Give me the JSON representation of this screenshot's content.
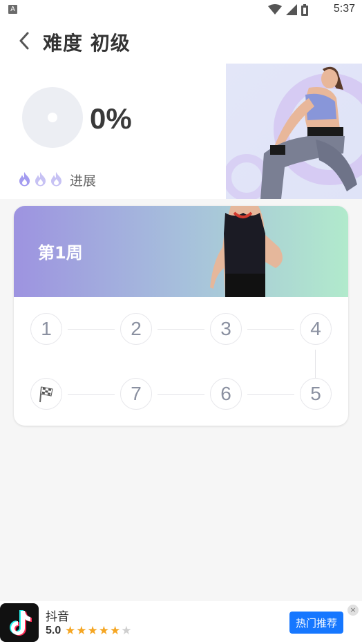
{
  "status_bar": {
    "indicator": "A",
    "time": "5:37",
    "icons": [
      "wifi-icon",
      "signal-icon",
      "battery-icon"
    ]
  },
  "header": {
    "title": "难度 初级"
  },
  "progress": {
    "percent_text": "0%",
    "percent": 0,
    "label": "进展",
    "flame_color": "#8f86e8"
  },
  "week": {
    "title": "第1周",
    "days": [
      "1",
      "2",
      "3",
      "4",
      "5",
      "6",
      "7"
    ],
    "finish_icon": "checkered-flag-icon"
  },
  "ad": {
    "app_name": "抖音",
    "rating": "5.0",
    "stars_filled": 4.5,
    "cta": "热门推荐",
    "close": "×"
  },
  "colors": {
    "accent": "#9d93e0",
    "banner_end": "#b1eacc",
    "cta": "#1677ff",
    "star": "#f5a623"
  }
}
